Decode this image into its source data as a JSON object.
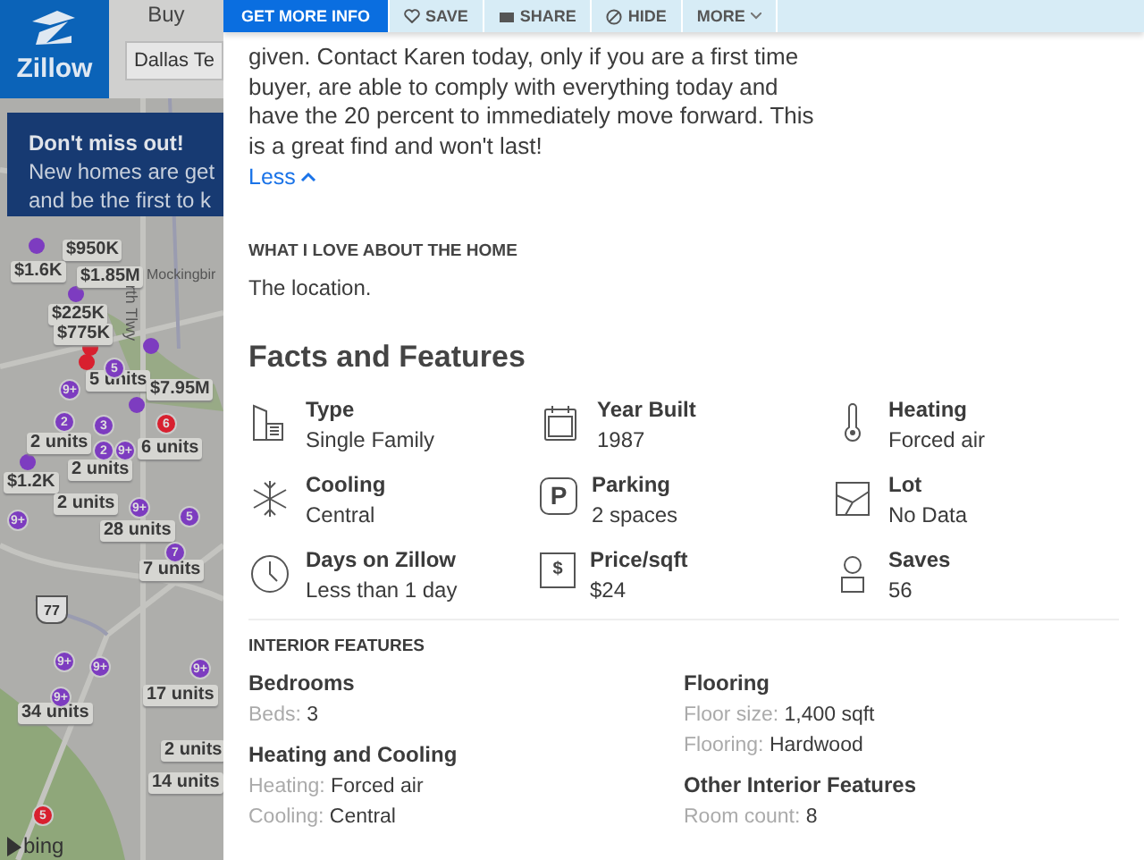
{
  "header": {
    "logo": "Zillow",
    "tab": "Buy",
    "search": {
      "value": "Dallas Te"
    }
  },
  "banner": {
    "title": "Don't miss out!",
    "text": "New homes are get\nand be the first to k"
  },
  "map": {
    "labels": [
      {
        "text": "$950K"
      },
      {
        "text": "$1.6K"
      },
      {
        "text": "$1.85M"
      },
      {
        "text": "$225K"
      },
      {
        "text": "$775K"
      },
      {
        "text": "5 units"
      },
      {
        "text": "$7.95M"
      },
      {
        "text": "2 units"
      },
      {
        "text": "6 units"
      },
      {
        "text": "2 units"
      },
      {
        "text": "$1.2K"
      },
      {
        "text": "2 units"
      },
      {
        "text": "28 units"
      },
      {
        "text": "7 units"
      },
      {
        "text": "17 units"
      },
      {
        "text": "34 units"
      },
      {
        "text": "2 units"
      },
      {
        "text": "14 units"
      }
    ],
    "badges": [
      {
        "text": "5",
        "color": "#7d3cc0"
      },
      {
        "text": "9+",
        "color": "#7d3cc0"
      },
      {
        "text": "2",
        "color": "#7d3cc0"
      },
      {
        "text": "3",
        "color": "#7d3cc0"
      },
      {
        "text": "6",
        "color": "#d8202f"
      },
      {
        "text": "2",
        "color": "#7d3cc0"
      },
      {
        "text": "9+",
        "color": "#7d3cc0"
      },
      {
        "text": "9+",
        "color": "#7d3cc0"
      },
      {
        "text": "9+",
        "color": "#7d3cc0"
      },
      {
        "text": "5",
        "color": "#7d3cc0"
      },
      {
        "text": "7",
        "color": "#7d3cc0"
      },
      {
        "text": "9+",
        "color": "#7d3cc0"
      },
      {
        "text": "9+",
        "color": "#7d3cc0"
      },
      {
        "text": "9+",
        "color": "#7d3cc0"
      },
      {
        "text": "9+",
        "color": "#7d3cc0"
      },
      {
        "text": "5",
        "color": "#d8202f"
      }
    ],
    "dots": [
      {
        "color": "#7d3cc0"
      },
      {
        "color": "#d8202f"
      },
      {
        "color": "#7d3cc0"
      },
      {
        "color": "#7d3cc0"
      },
      {
        "color": "#7d3cc0"
      },
      {
        "color": "#7d3cc0"
      },
      {
        "color": "#d8202f"
      }
    ],
    "streets": [
      {
        "text": "Mockingbir"
      },
      {
        "text": "rth Tlwy"
      }
    ],
    "highway": "77",
    "attribution": "bing"
  },
  "actions": [
    {
      "label": "GET MORE INFO",
      "kind": "primary"
    },
    {
      "label": "SAVE",
      "kind": "heart"
    },
    {
      "label": "SHARE",
      "kind": "share"
    },
    {
      "label": "HIDE",
      "kind": "hide"
    },
    {
      "label": "MORE",
      "kind": "more"
    }
  ],
  "description": {
    "text": "given. Contact Karen today, only if you are a first time buyer, are able to comply with everything today and have the 20 percent to immediately move forward. This is a great find and won't last!",
    "toggle": "Less"
  },
  "love": {
    "heading": "WHAT I LOVE ABOUT THE HOME",
    "text": "The location."
  },
  "facts": {
    "title": "Facts and Features",
    "items": [
      {
        "kind": "type",
        "label": "Type",
        "value": "Single Family"
      },
      {
        "kind": "calendar",
        "label": "Year Built",
        "value": "1987"
      },
      {
        "kind": "thermometer",
        "label": "Heating",
        "value": "Forced air"
      },
      {
        "kind": "snowflake",
        "label": "Cooling",
        "value": "Central"
      },
      {
        "kind": "parking",
        "glyph": "P",
        "label": "Parking",
        "value": "2 spaces"
      },
      {
        "kind": "lot",
        "label": "Lot",
        "value": "No Data"
      },
      {
        "kind": "clock",
        "label": "Days on Zillow",
        "value": "Less than 1 day"
      },
      {
        "kind": "price",
        "glyph": "$",
        "label": "Price/sqft",
        "value": "$24"
      },
      {
        "kind": "person",
        "label": "Saves",
        "value": "56"
      }
    ]
  },
  "interior": {
    "heading": "INTERIOR FEATURES",
    "columns": [
      [
        {
          "title": "Bedrooms",
          "rows": [
            {
              "key": "Beds:",
              "value": "3"
            }
          ]
        },
        {
          "title": "Heating and Cooling",
          "rows": [
            {
              "key": "Heating:",
              "value": "Forced air"
            },
            {
              "key": "Cooling:",
              "value": "Central"
            }
          ]
        }
      ],
      [
        {
          "title": "Flooring",
          "rows": [
            {
              "key": "Floor size:",
              "value": "1,400 sqft"
            },
            {
              "key": "Flooring:",
              "value": "Hardwood"
            }
          ]
        },
        {
          "title": "Other Interior Features",
          "rows": [
            {
              "key": "Room count:",
              "value": "8"
            }
          ]
        }
      ]
    ]
  }
}
